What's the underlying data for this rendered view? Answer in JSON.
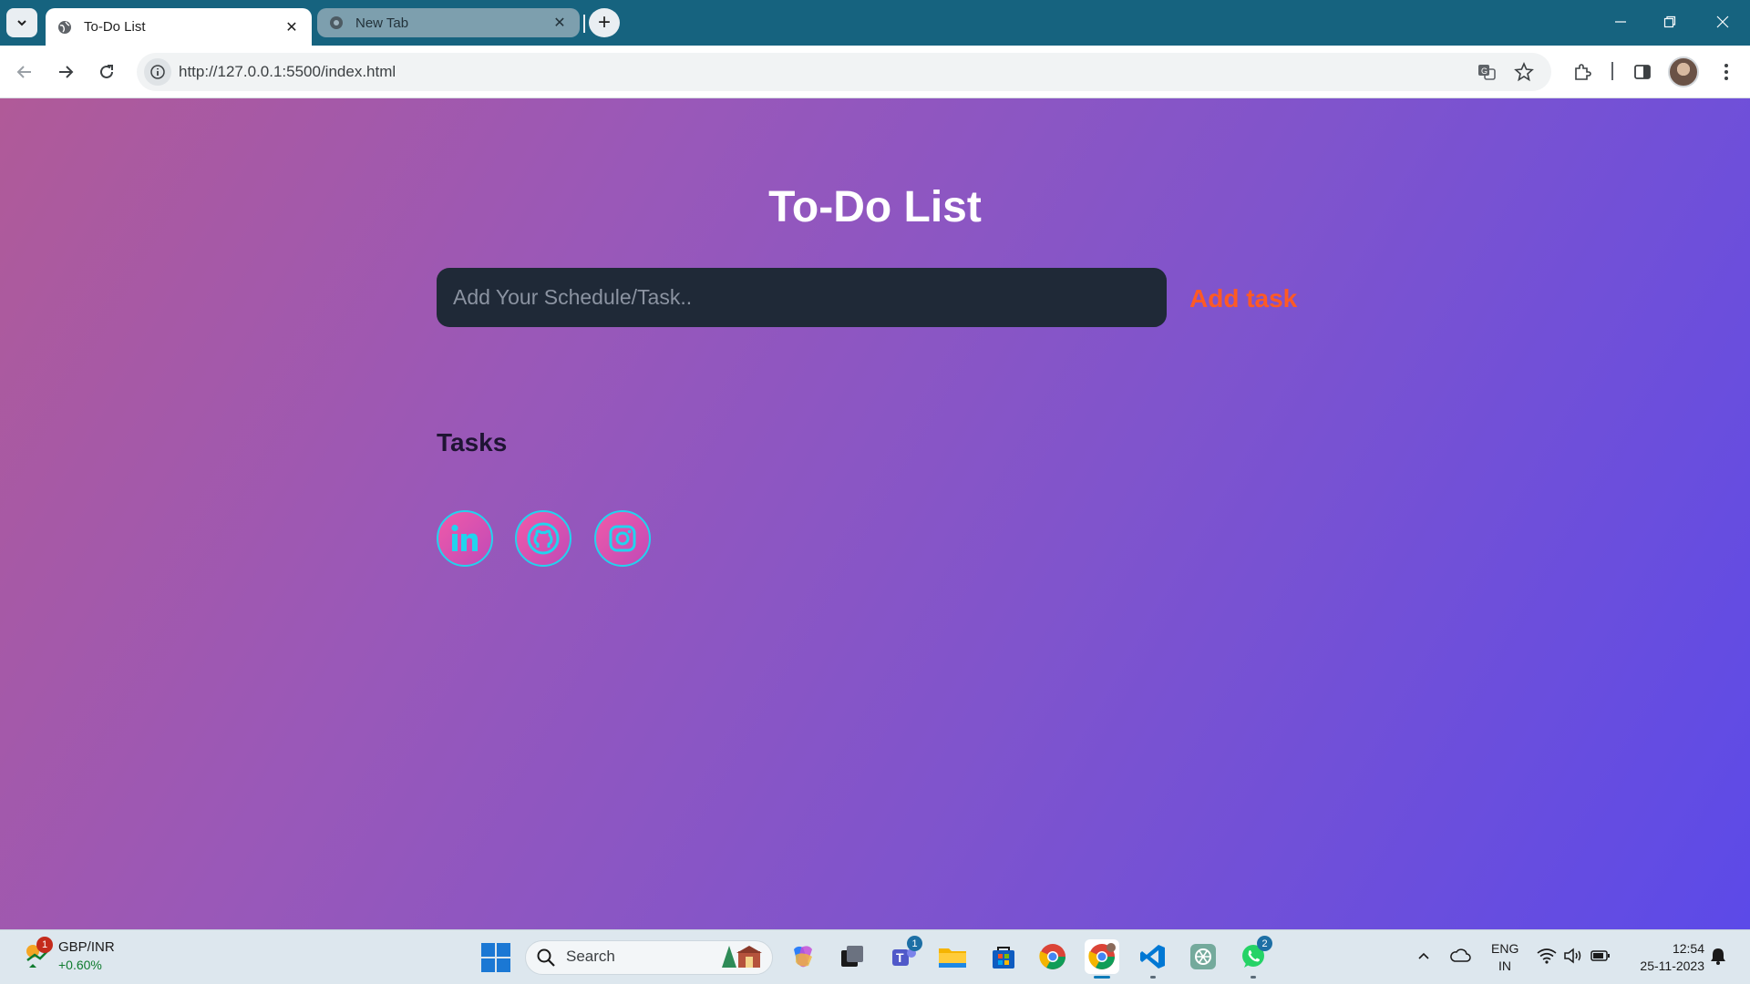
{
  "browser": {
    "tabs": [
      {
        "title": "To-Do List",
        "active": true
      },
      {
        "title": "New Tab",
        "active": false
      }
    ],
    "url": "http://127.0.0.1:5500/index.html"
  },
  "page": {
    "title": "To-Do List",
    "input_placeholder": "Add Your Schedule/Task..",
    "input_value": "",
    "add_button_label": "Add task",
    "tasks_heading": "Tasks",
    "social_links": [
      {
        "name": "linkedin",
        "icon": "linkedin-icon"
      },
      {
        "name": "github",
        "icon": "github-icon"
      },
      {
        "name": "instagram",
        "icon": "instagram-icon"
      }
    ],
    "colors": {
      "gradient_start": "#b05a98",
      "gradient_end": "#5c4ae8",
      "input_bg": "#1f2937",
      "add_button": "#ff5a24",
      "social_ring": "#22d3ee"
    }
  },
  "taskbar": {
    "widget": {
      "title": "GBP/INR",
      "change": "+0.60%",
      "badge": "1"
    },
    "search_label": "Search",
    "apps": [
      {
        "name": "copilot"
      },
      {
        "name": "task-view"
      },
      {
        "name": "teams",
        "badge": "1"
      },
      {
        "name": "file-explorer"
      },
      {
        "name": "microsoft-store"
      },
      {
        "name": "chrome"
      },
      {
        "name": "chrome-profile"
      },
      {
        "name": "vscode"
      },
      {
        "name": "chatgpt"
      },
      {
        "name": "whatsapp",
        "badge": "2"
      }
    ],
    "language": {
      "line1": "ENG",
      "line2": "IN"
    },
    "time": "12:54",
    "date": "25-11-2023"
  }
}
